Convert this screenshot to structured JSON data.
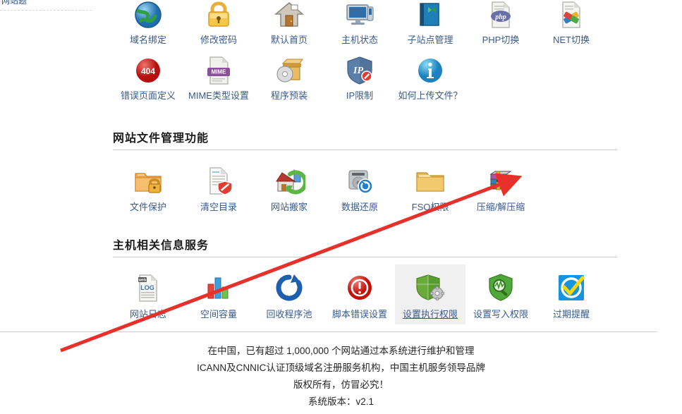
{
  "sidebar": {
    "clipped_label": "网站题"
  },
  "rows": {
    "row1": [
      {
        "label": "域名绑定",
        "icon": "globe-icon"
      },
      {
        "label": "修改密码",
        "icon": "padlock-icon"
      },
      {
        "label": "默认首页",
        "icon": "house-icon"
      },
      {
        "label": "主机状态",
        "icon": "monitor-icon"
      },
      {
        "label": "子站点管理",
        "icon": "book-icon"
      },
      {
        "label": "PHP切换",
        "icon": "php-file-icon"
      },
      {
        "label": "NET切换",
        "icon": "net-file-icon"
      }
    ],
    "row2": [
      {
        "label": "错误页面定义",
        "icon": "error-404-icon"
      },
      {
        "label": "MIME类型设置",
        "icon": "mime-file-icon"
      },
      {
        "label": "程序预装",
        "icon": "software-box-icon"
      },
      {
        "label": "IP限制",
        "icon": "ip-shield-icon"
      },
      {
        "label": "如何上传文件？",
        "icon": "info-icon"
      }
    ],
    "row3": [
      {
        "label": "文件保护",
        "icon": "folder-lock-icon"
      },
      {
        "label": "清空目录",
        "icon": "document-shield-icon"
      },
      {
        "label": "网站搬家",
        "icon": "house-migrate-icon"
      },
      {
        "label": "数据还原",
        "icon": "disk-restore-icon"
      },
      {
        "label": "FSO权限",
        "icon": "open-folder-icon"
      },
      {
        "label": "压缩/解压缩",
        "icon": "archive-icon"
      }
    ],
    "row4": [
      {
        "label": "网站日志",
        "icon": "weblog-file-icon"
      },
      {
        "label": "空间容量",
        "icon": "bar-chart-icon"
      },
      {
        "label": "回收程序池",
        "icon": "recycle-refresh-icon"
      },
      {
        "label": "脚本错误设置",
        "icon": "alert-exclamation-icon"
      },
      {
        "label": "设置执行权限",
        "icon": "shield-gear-icon",
        "highlighted": true
      },
      {
        "label": "设置写入权限",
        "icon": "shield-search-icon"
      },
      {
        "label": "过期提醒",
        "icon": "check-circle-icon"
      }
    ]
  },
  "sections": {
    "files_title": "网站文件管理功能",
    "info_title": "主机相关信息服务"
  },
  "footer": {
    "line1": "在中国，已有超过 1,000,000 个网站通过本系统进行维护和管理",
    "line2": "ICANN及CNNIC认证顶级域名注册服务机构，中国主机服务领导品牌",
    "line3": "版权所有，仿冒必究！",
    "line4": "系统版本：v2.1"
  },
  "annotation": {
    "arrow_color": "#e8302a",
    "arrow_points_to": "压缩/解压缩"
  },
  "colors": {
    "link": "#3a5a8c",
    "heading": "#1c1c1c",
    "highlight_bg": "#f0f0f0",
    "rule": "#c9c9c9"
  }
}
